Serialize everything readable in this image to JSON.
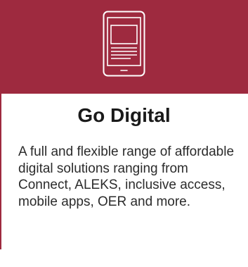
{
  "card": {
    "icon": "tablet-icon",
    "title": "Go Digital",
    "description": "A full and flexible range of affordable digital solutions ranging from Connect, ALEKS, inclusive access, mobile apps, OER and more."
  },
  "colors": {
    "banner": "#9e2a3f",
    "icon_stroke": "#ffffff",
    "title_text": "#1a1a1a",
    "body_text": "#2b2b2b"
  }
}
